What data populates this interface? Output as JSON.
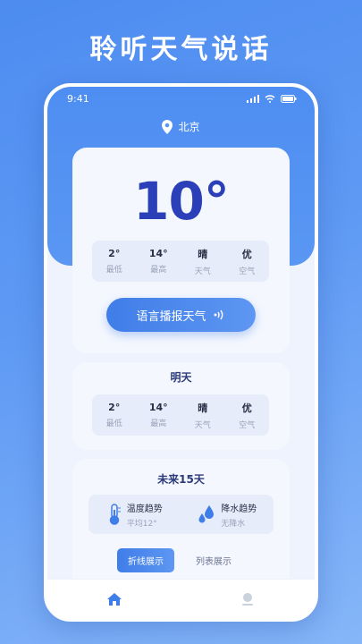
{
  "promo": {
    "title": "聆听天气说话"
  },
  "status_bar": {
    "time": "9:41"
  },
  "location": {
    "city": "北京"
  },
  "today": {
    "temperature": "10°",
    "stats": [
      {
        "value": "2°",
        "label": "最低"
      },
      {
        "value": "14°",
        "label": "最高"
      },
      {
        "value": "晴",
        "label": "天气"
      },
      {
        "value": "优",
        "label": "空气"
      }
    ],
    "speak_button": "语言播报天气"
  },
  "tomorrow": {
    "title": "明天",
    "stats": [
      {
        "value": "2°",
        "label": "最低"
      },
      {
        "value": "14°",
        "label": "最高"
      },
      {
        "value": "晴",
        "label": "天气"
      },
      {
        "value": "优",
        "label": "空气"
      }
    ]
  },
  "forecast": {
    "title": "未来15天",
    "temp_trend": {
      "title": "温度趋势",
      "sub": "平均12°"
    },
    "rain_trend": {
      "title": "降水趋势",
      "sub": "无降水"
    },
    "tabs": [
      "折线展示",
      "列表展示"
    ]
  },
  "colors": {
    "accent": "#3f7de8",
    "temperature": "#2a3fb8",
    "background": "#4d8cf0"
  }
}
